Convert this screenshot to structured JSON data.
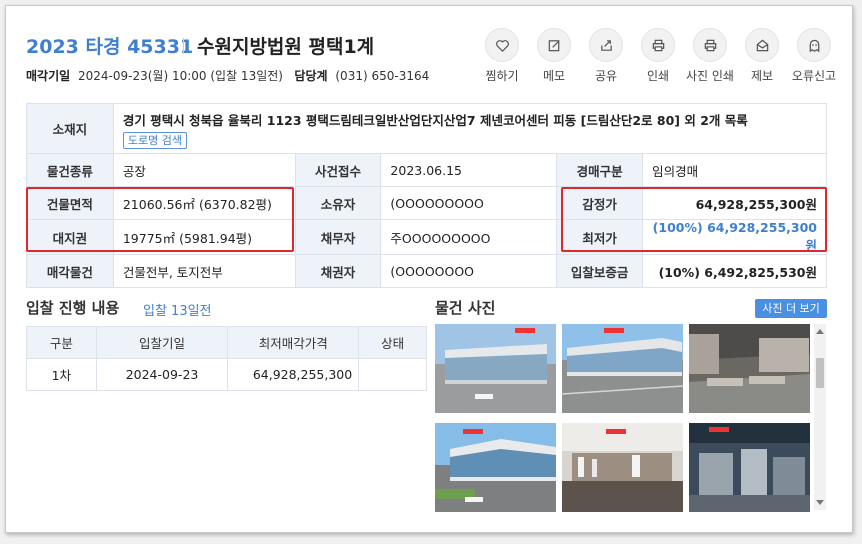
{
  "header": {
    "case_no": "2023 타경 45331",
    "court": "수원지방법원 평택1계",
    "sale_date_label": "매각기일",
    "sale_date_value": "2024-09-23(월) 10:00 (입찰 13일전)",
    "manager_label": "담당계",
    "manager_value": "(031) 650-3164"
  },
  "actions": [
    {
      "label": "찜하기",
      "icon": "heart-icon"
    },
    {
      "label": "메모",
      "icon": "memo-icon"
    },
    {
      "label": "공유",
      "icon": "share-icon"
    },
    {
      "label": "인쇄",
      "icon": "print-icon"
    },
    {
      "label": "사진 인쇄",
      "icon": "photo-print-icon"
    },
    {
      "label": "제보",
      "icon": "mail-icon"
    },
    {
      "label": "오류신고",
      "icon": "ghost-icon"
    }
  ],
  "info": {
    "address_label": "소재지",
    "address": "경기 평택시 청북읍 율북리 1123 평택드림테크일반산업단지산업7 제넨코어센터 피동 [드림산단2로 80] 외 2개 목록",
    "road_btn": "도로명 검색",
    "type_label": "물건종류",
    "type": "공장",
    "received_label": "사건접수",
    "received": "2023.06.15",
    "auction_type_label": "경매구분",
    "auction_type": "임의경매",
    "bldg_area_label": "건물면적",
    "bldg_area": "21060.56㎡ (6370.82평)",
    "owner_label": "소유자",
    "owner": "(OOOOOOOOO",
    "appraisal_label": "감정가",
    "appraisal": "64,928,255,300원",
    "land_label": "대지권",
    "land": "19775㎡ (5981.94평)",
    "debtor_label": "채무자",
    "debtor": "주OOOOOOOOO",
    "min_price_label": "최저가",
    "min_price": "(100%) 64,928,255,300원",
    "sale_items_label": "매각물건",
    "sale_items": "건물전부, 토지전부",
    "creditor_label": "채권자",
    "creditor": "(OOOOOOOO",
    "deposit_label": "입찰보증금",
    "deposit": "(10%) 6,492,825,530원"
  },
  "bid": {
    "title": "입찰 진행 내용",
    "sub": "입찰 13일전",
    "headers": [
      "구분",
      "입찰기일",
      "최저매각가격",
      "상태"
    ],
    "rows": [
      {
        "round": "1차",
        "date": "2024-09-23",
        "price": "64,928,255,300",
        "status": ""
      }
    ]
  },
  "photos": {
    "title": "물건 사진",
    "more_btn": "사진 더 보기",
    "items": [
      "building-photo-1",
      "building-photo-2",
      "interior-photo-1",
      "building-photo-3",
      "lab-photo",
      "machinery-photo"
    ]
  },
  "colors": {
    "accent": "#3f7fd0",
    "highlight": "#e0272e",
    "header_bg": "#eef3fa"
  }
}
